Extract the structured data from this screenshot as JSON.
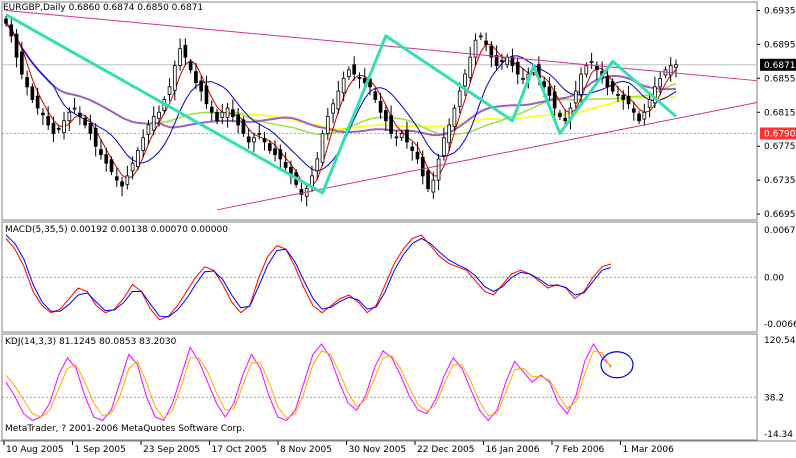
{
  "chart_header": "EURGBP,Daily  0.6860 0.6874 0.6850 0.6871",
  "macd_header": "MACD(5,35,5) 0.00192 0.00138 0.00070 0.00000",
  "kdj_header": "KDJ(14,3,3) 81.1245 80.0853 83.2030",
  "copyright": "MetaTrader, ? 2001-2006 MetaQuotes Software Corp.",
  "price_axis_ticks": [
    "0.6935",
    "0.6895",
    "0.6855",
    "0.6815",
    "0.6775",
    "0.6735",
    "0.6695"
  ],
  "current_price_label": "0.6871",
  "red_line_label": "0.6790",
  "macd_axis_ticks": [
    "0.00671",
    "0.00",
    "-0.0066"
  ],
  "kdj_axis_ticks": [
    "120.544",
    "38.2",
    "-14.34"
  ],
  "date_ticks": [
    "10 Aug 2005",
    "1 Sep 2005",
    "23 Sep 2005",
    "17 Oct 2005",
    "8 Nov 2005",
    "30 Nov 2005",
    "22 Dec 2005",
    "16 Jan 2006",
    "7 Feb 2006",
    "1 Mar 2006"
  ],
  "colors": {
    "background": "#ffffff",
    "grid": "#c0c0c0",
    "candles": "#000000",
    "trend_lines": "#cc3399",
    "zigzag": "#33e0b0",
    "ma_yellow": "#ffff00",
    "ma_green": "#99e040",
    "ma_purple": "#a060c0",
    "ma_blue": "#0000cc",
    "ma_red": "#cc0000",
    "macd_line": "#ff0000",
    "signal_line": "#0000ff",
    "k_line": "#ff00ff",
    "d_line": "#ffaa00",
    "j_line": "#cc0000",
    "circle": "#0000cc",
    "current_price_bg": "#000000",
    "red_level_bg": "#ff3333"
  },
  "chart_data": [
    {
      "type": "candlestick",
      "title": "EURGBP,Daily",
      "ohlc_last": {
        "open": 0.686,
        "high": 0.6874,
        "low": 0.685,
        "close": 0.6871
      },
      "ylim": [
        0.6688,
        0.6945
      ],
      "x_tick_labels": [
        "10 Aug 2005",
        "1 Sep 2005",
        "23 Sep 2005",
        "17 Oct 2005",
        "8 Nov 2005",
        "30 Nov 2005",
        "22 Dec 2005",
        "16 Jan 2006",
        "7 Feb 2006",
        "1 Mar 2006"
      ],
      "closes": [
        0.692,
        0.6905,
        0.688,
        0.686,
        0.6845,
        0.683,
        0.682,
        0.6812,
        0.68,
        0.679,
        0.6795,
        0.6805,
        0.6815,
        0.682,
        0.681,
        0.68,
        0.679,
        0.6775,
        0.6765,
        0.6755,
        0.6745,
        0.6735,
        0.6728,
        0.674,
        0.6755,
        0.677,
        0.6785,
        0.68,
        0.681,
        0.6815,
        0.683,
        0.6845,
        0.687,
        0.689,
        0.688,
        0.6865,
        0.685,
        0.684,
        0.6825,
        0.6815,
        0.6805,
        0.6815,
        0.682,
        0.681,
        0.68,
        0.679,
        0.678,
        0.6785,
        0.679,
        0.678,
        0.677,
        0.6765,
        0.676,
        0.675,
        0.674,
        0.673,
        0.6718,
        0.6725,
        0.674,
        0.676,
        0.679,
        0.681,
        0.6825,
        0.684,
        0.6855,
        0.6865,
        0.686,
        0.6855,
        0.685,
        0.6845,
        0.683,
        0.6815,
        0.6805,
        0.679,
        0.6785,
        0.679,
        0.678,
        0.677,
        0.676,
        0.674,
        0.6725,
        0.6735,
        0.676,
        0.6785,
        0.68,
        0.682,
        0.684,
        0.686,
        0.688,
        0.69,
        0.6905,
        0.6895,
        0.688,
        0.687,
        0.6875,
        0.688,
        0.687,
        0.686,
        0.6855,
        0.686,
        0.6865,
        0.6855,
        0.6845,
        0.6835,
        0.682,
        0.681,
        0.6805,
        0.682,
        0.684,
        0.686,
        0.687,
        0.6875,
        0.6865,
        0.6855,
        0.6845,
        0.684,
        0.6835,
        0.683,
        0.6825,
        0.6815,
        0.6805,
        0.6815,
        0.683,
        0.6845,
        0.6855,
        0.6865,
        0.687,
        0.6871
      ],
      "horizontal_levels": [
        0.6871,
        0.679
      ],
      "trend_lines": [
        {
          "points": [
            [
              0,
              0.6935
            ],
            [
              129,
              0.686
            ]
          ]
        },
        {
          "points": [
            [
              40,
              0.67
            ],
            [
              129,
              0.681
            ]
          ]
        }
      ],
      "zigzag": [
        [
          0,
          0.693
        ],
        [
          60,
          0.672
        ],
        [
          72,
          0.6905
        ],
        [
          96,
          0.6805
        ],
        [
          100,
          0.687
        ],
        [
          105,
          0.679
        ]
      ]
    },
    {
      "type": "line",
      "title": "MACD(5,35,5)",
      "values_last": [
        0.00192,
        0.00138,
        0.0007,
        0.0
      ],
      "ylim": [
        -0.0066,
        0.00671
      ],
      "series": [
        {
          "name": "MACD",
          "values": [
            0.0055,
            0.004,
            0.0015,
            -0.002,
            -0.004,
            -0.005,
            -0.0045,
            -0.003,
            -0.0015,
            -0.002,
            -0.004,
            -0.005,
            -0.0045,
            -0.003,
            -0.001,
            -0.002,
            -0.0045,
            -0.006,
            -0.0055,
            -0.004,
            -0.002,
            0.0,
            0.0015,
            0.001,
            -0.001,
            -0.0035,
            -0.005,
            -0.004,
            0.0,
            0.003,
            0.0045,
            0.004,
            0.0015,
            -0.0015,
            -0.004,
            -0.005,
            -0.004,
            -0.003,
            -0.0025,
            -0.0035,
            -0.005,
            -0.004,
            -0.001,
            0.002,
            0.004,
            0.0055,
            0.006,
            0.0045,
            0.003,
            0.002,
            0.0015,
            0.001,
            -0.0005,
            -0.002,
            -0.0025,
            -0.001,
            0.0005,
            0.001,
            0.0005,
            -0.0005,
            -0.0015,
            -0.001,
            -0.0015,
            -0.003,
            -0.002,
            0.0,
            0.0015,
            0.0019
          ]
        },
        {
          "name": "Signal",
          "values": [
            0.006,
            0.0048,
            0.0025,
            -0.001,
            -0.0035,
            -0.0048,
            -0.0048,
            -0.0038,
            -0.0025,
            -0.0022,
            -0.0035,
            -0.0047,
            -0.0046,
            -0.0036,
            -0.002,
            -0.002,
            -0.0038,
            -0.0055,
            -0.0056,
            -0.0046,
            -0.003,
            -0.001,
            0.0008,
            0.0009,
            -0.0003,
            -0.0025,
            -0.0043,
            -0.0041,
            -0.0012,
            0.0018,
            0.0038,
            0.004,
            0.0022,
            -0.0005,
            -0.003,
            -0.0045,
            -0.0042,
            -0.0034,
            -0.0028,
            -0.0032,
            -0.0045,
            -0.0042,
            -0.002,
            0.001,
            0.0032,
            0.0048,
            0.0055,
            0.0048,
            0.0036,
            0.0025,
            0.0018,
            0.0012,
            0.0002,
            -0.0013,
            -0.002,
            -0.0013,
            0.0,
            0.0007,
            0.0005,
            -0.0002,
            -0.0011,
            -0.0011,
            -0.0014,
            -0.0025,
            -0.0022,
            -0.0006,
            0.001,
            0.0014
          ]
        }
      ]
    },
    {
      "type": "line",
      "title": "KDJ(14,3,3)",
      "values_last": [
        81.1245,
        80.0853,
        83.203
      ],
      "ylim": [
        -14.34,
        120.544
      ],
      "series": [
        {
          "name": "K",
          "values": [
            60,
            40,
            15,
            5,
            10,
            30,
            70,
            95,
            80,
            40,
            10,
            5,
            20,
            60,
            100,
            85,
            40,
            10,
            5,
            30,
            70,
            110,
            90,
            60,
            30,
            10,
            30,
            70,
            100,
            80,
            40,
            10,
            5,
            20,
            60,
            100,
            115,
            95,
            60,
            30,
            20,
            40,
            80,
            105,
            95,
            70,
            40,
            20,
            15,
            35,
            70,
            95,
            80,
            50,
            20,
            5,
            20,
            60,
            90,
            75,
            60,
            70,
            60,
            30,
            15,
            40,
            90,
            115,
            95,
            83
          ]
        },
        {
          "name": "D",
          "values": [
            70,
            55,
            35,
            15,
            10,
            20,
            50,
            80,
            85,
            60,
            30,
            12,
            15,
            40,
            80,
            90,
            60,
            25,
            8,
            20,
            55,
            95,
            95,
            75,
            45,
            20,
            22,
            55,
            88,
            88,
            60,
            25,
            8,
            15,
            45,
            85,
            105,
            100,
            75,
            45,
            25,
            35,
            65,
            95,
            98,
            80,
            52,
            28,
            18,
            28,
            58,
            85,
            85,
            62,
            32,
            12,
            15,
            45,
            78,
            80,
            68,
            68,
            63,
            42,
            22,
            32,
            72,
            105,
            102,
            80
          ]
        }
      ]
    }
  ]
}
